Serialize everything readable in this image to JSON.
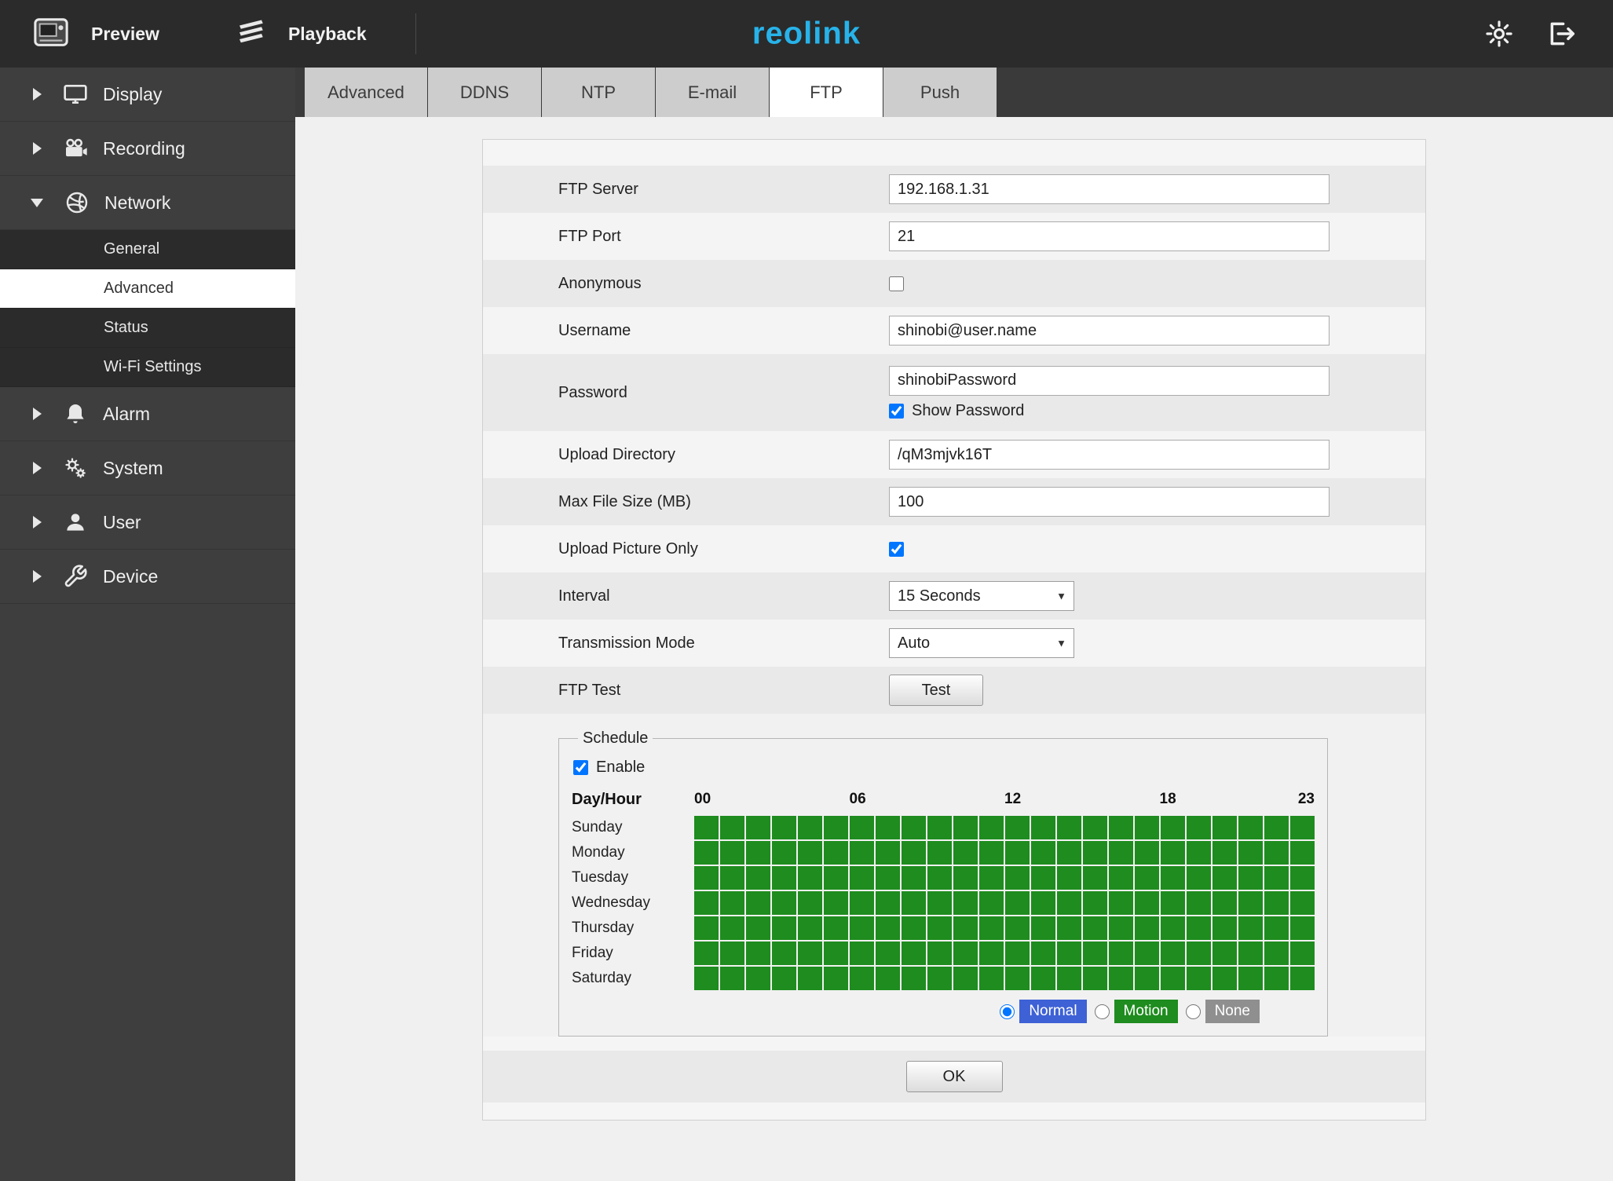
{
  "topbar": {
    "preview_label": "Preview",
    "playback_label": "Playback",
    "logo_text": "reolink"
  },
  "sidebar": {
    "items": [
      {
        "label": "Display"
      },
      {
        "label": "Recording"
      },
      {
        "label": "Network"
      },
      {
        "label": "Alarm"
      },
      {
        "label": "System"
      },
      {
        "label": "User"
      },
      {
        "label": "Device"
      }
    ],
    "network_children": [
      {
        "label": "General"
      },
      {
        "label": "Advanced"
      },
      {
        "label": "Status"
      },
      {
        "label": "Wi-Fi Settings"
      }
    ],
    "active_child": "Advanced"
  },
  "tabs": {
    "labels": [
      "Advanced",
      "DDNS",
      "NTP",
      "E-mail",
      "FTP",
      "Push"
    ],
    "active": "FTP"
  },
  "form": {
    "ftp_server": {
      "label": "FTP Server",
      "value": "192.168.1.31"
    },
    "ftp_port": {
      "label": "FTP Port",
      "value": "21"
    },
    "anonymous": {
      "label": "Anonymous",
      "checked": false
    },
    "username": {
      "label": "Username",
      "value": "shinobi@user.name"
    },
    "password": {
      "label": "Password",
      "value": "shinobiPassword",
      "show_password_label": "Show Password",
      "show_password_checked": true
    },
    "upload_directory": {
      "label": "Upload Directory",
      "value": "/qM3mjvk16T"
    },
    "max_file_size": {
      "label": "Max File Size (MB)",
      "value": "100"
    },
    "upload_picture_only": {
      "label": "Upload Picture Only",
      "checked": true
    },
    "interval": {
      "label": "Interval",
      "value": "15 Seconds"
    },
    "transmission_mode": {
      "label": "Transmission Mode",
      "value": "Auto"
    },
    "ftp_test": {
      "label": "FTP Test",
      "button_label": "Test"
    }
  },
  "schedule": {
    "legend": "Schedule",
    "enable_label": "Enable",
    "enable_checked": true,
    "day_hour_label": "Day/Hour",
    "hour_labels": [
      "00",
      "06",
      "12",
      "18",
      "23"
    ],
    "days": [
      "Sunday",
      "Monday",
      "Tuesday",
      "Wednesday",
      "Thursday",
      "Friday",
      "Saturday"
    ],
    "columns": 24,
    "grid_fill": "#1e8c1e",
    "modes": [
      {
        "label": "Normal",
        "selected": true,
        "color": "#3e61d6"
      },
      {
        "label": "Motion",
        "selected": false,
        "color": "#1e8c1e"
      },
      {
        "label": "None",
        "selected": false,
        "color": "#8f8f8f"
      }
    ]
  },
  "ok_label": "OK",
  "colors": {
    "brand": "#27b3ea",
    "grid_green": "#1e8c1e",
    "normal_blue": "#3e61d6",
    "none_gray": "#8f8f8f"
  }
}
